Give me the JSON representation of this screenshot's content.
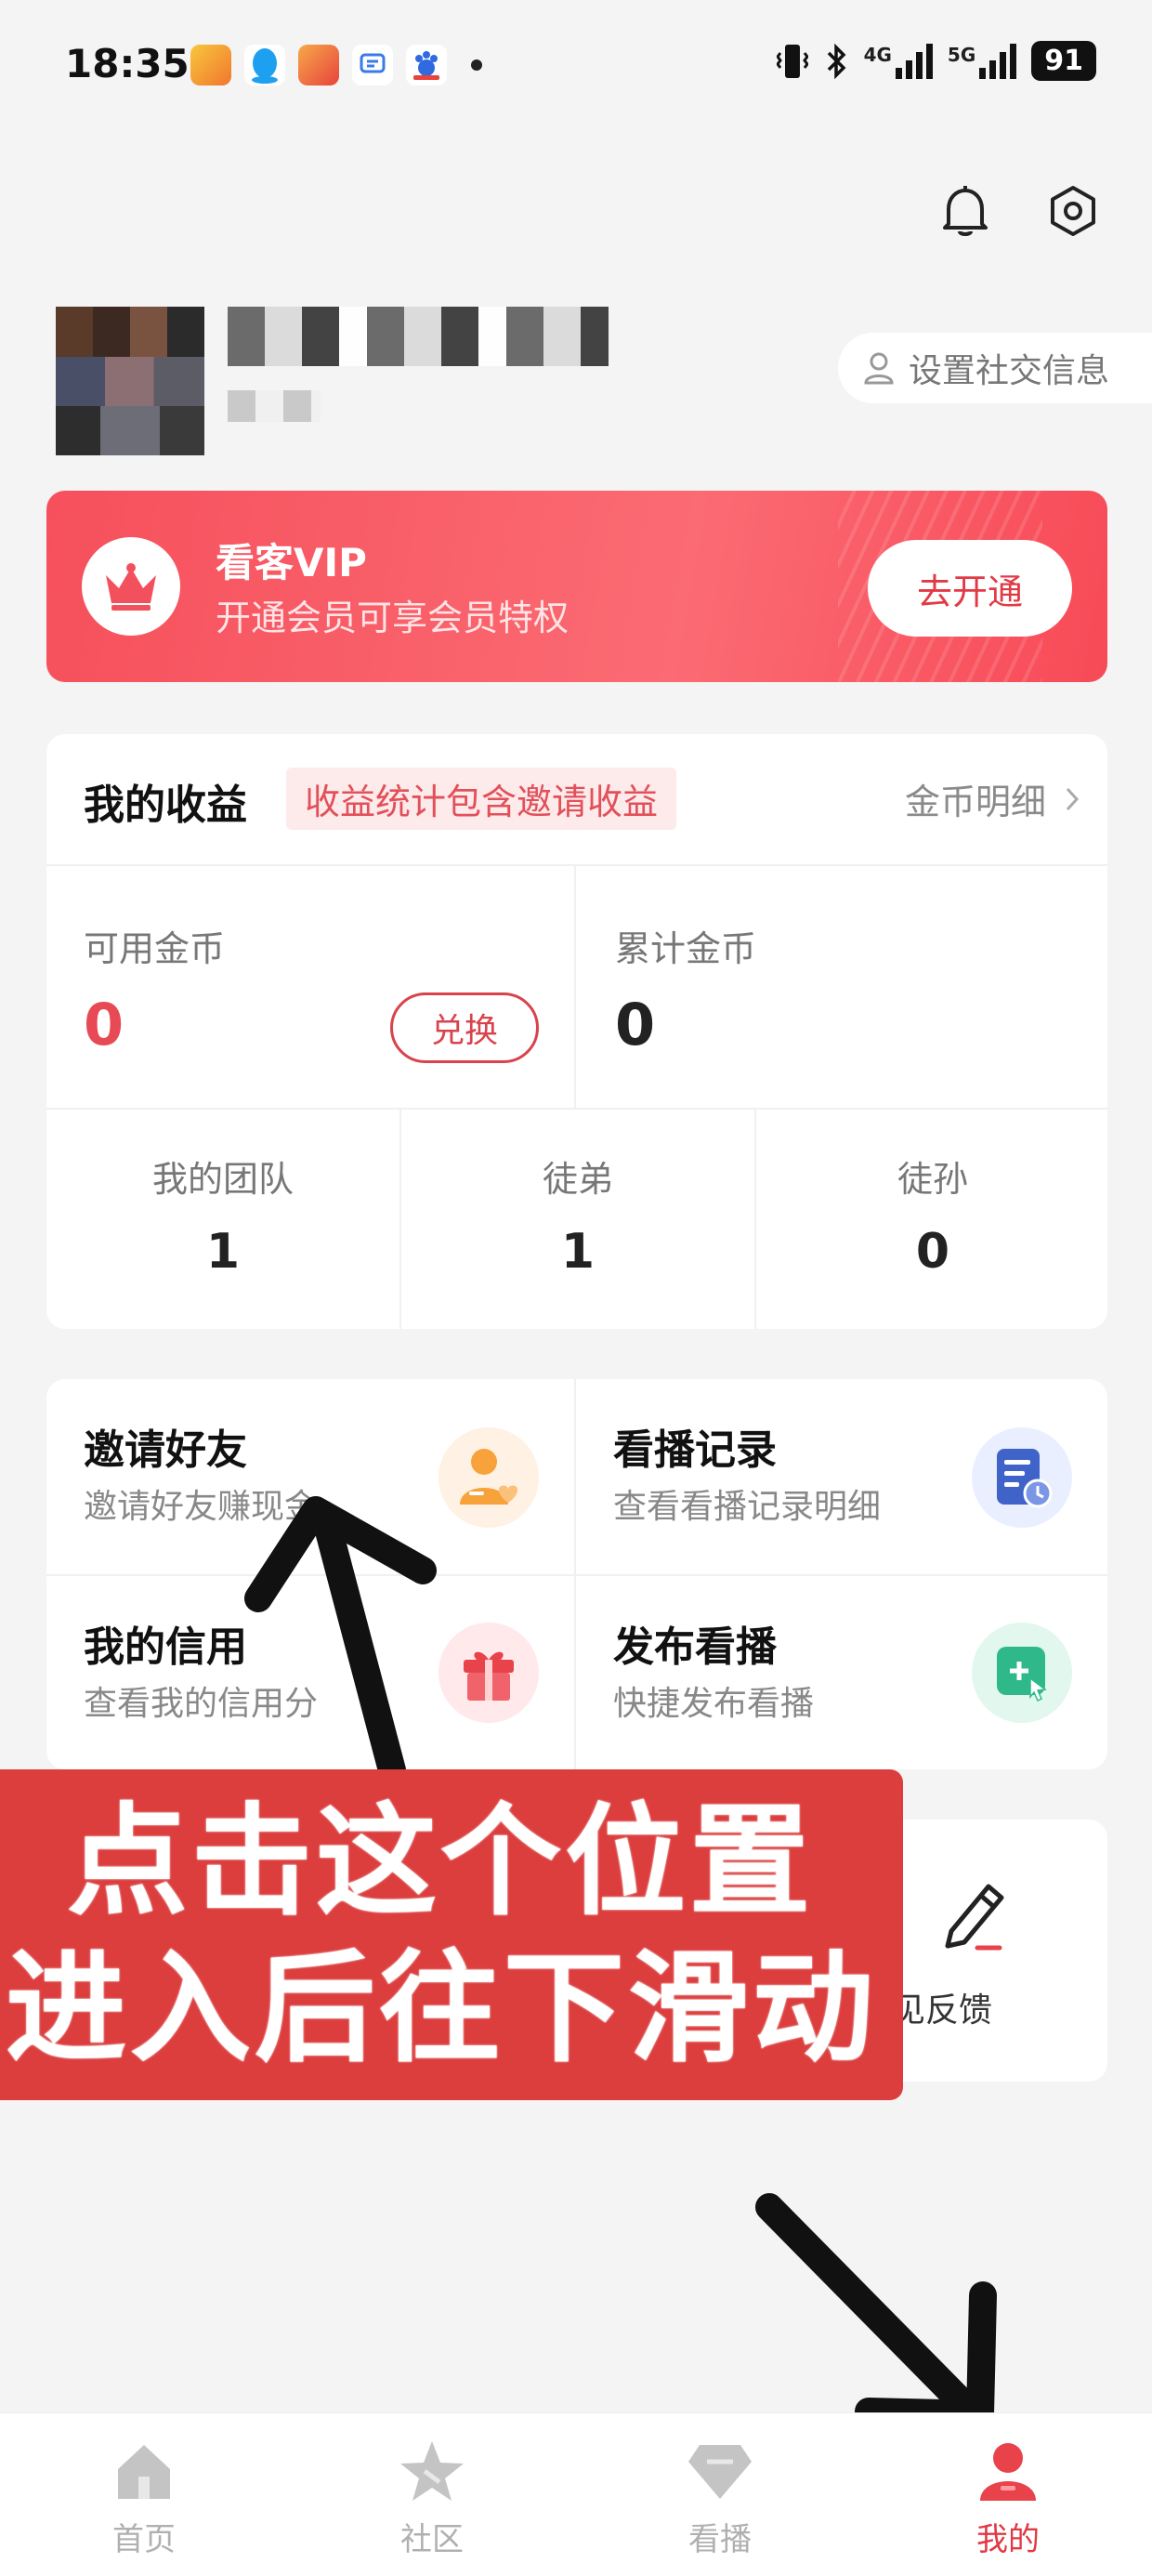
{
  "status_bar": {
    "time": "18:35",
    "network_4g": "4G",
    "network_5g": "5G",
    "battery": "91"
  },
  "header": {
    "icons": [
      "bell-icon",
      "settings-icon"
    ]
  },
  "profile": {
    "social_button_label": "设置社交信息"
  },
  "vip": {
    "title": "看客VIP",
    "subtitle": "开通会员可享会员特权",
    "button_label": "去开通"
  },
  "earnings": {
    "title": "我的收益",
    "tag": "收益统计包含邀请收益",
    "detail_link": "金币明细",
    "available_label": "可用金币",
    "available_value": "0",
    "exchange_label": "兑换",
    "total_label": "累计金币",
    "total_value": "0",
    "team": [
      {
        "label": "我的团队",
        "value": "1"
      },
      {
        "label": "徒弟",
        "value": "1"
      },
      {
        "label": "徒孙",
        "value": "0"
      }
    ]
  },
  "tools": [
    {
      "title": "邀请好友",
      "subtitle": "邀请好友赚现金",
      "icon": "invite-person-icon",
      "color": "#f7a23a"
    },
    {
      "title": "看播记录",
      "subtitle": "查看看播记录明细",
      "icon": "record-document-icon",
      "color": "#3f63c9"
    },
    {
      "title": "我的信用",
      "subtitle": "查看我的信用分",
      "icon": "gift-icon",
      "color": "#e8424b"
    },
    {
      "title": "发布看播",
      "subtitle": "快捷发布看播",
      "icon": "publish-icon",
      "color": "#2fb98a"
    }
  ],
  "feedback": {
    "label": "意见反馈",
    "icon": "pencil-icon"
  },
  "overlay": {
    "line1": "点击这个位置",
    "line2": "进入后往下滑动"
  },
  "tabbar": [
    {
      "label": "首页",
      "icon": "home-icon"
    },
    {
      "label": "社区",
      "icon": "star-icon"
    },
    {
      "label": "看播",
      "icon": "diamond-icon"
    },
    {
      "label": "我的",
      "icon": "person-icon",
      "active": true
    }
  ]
}
